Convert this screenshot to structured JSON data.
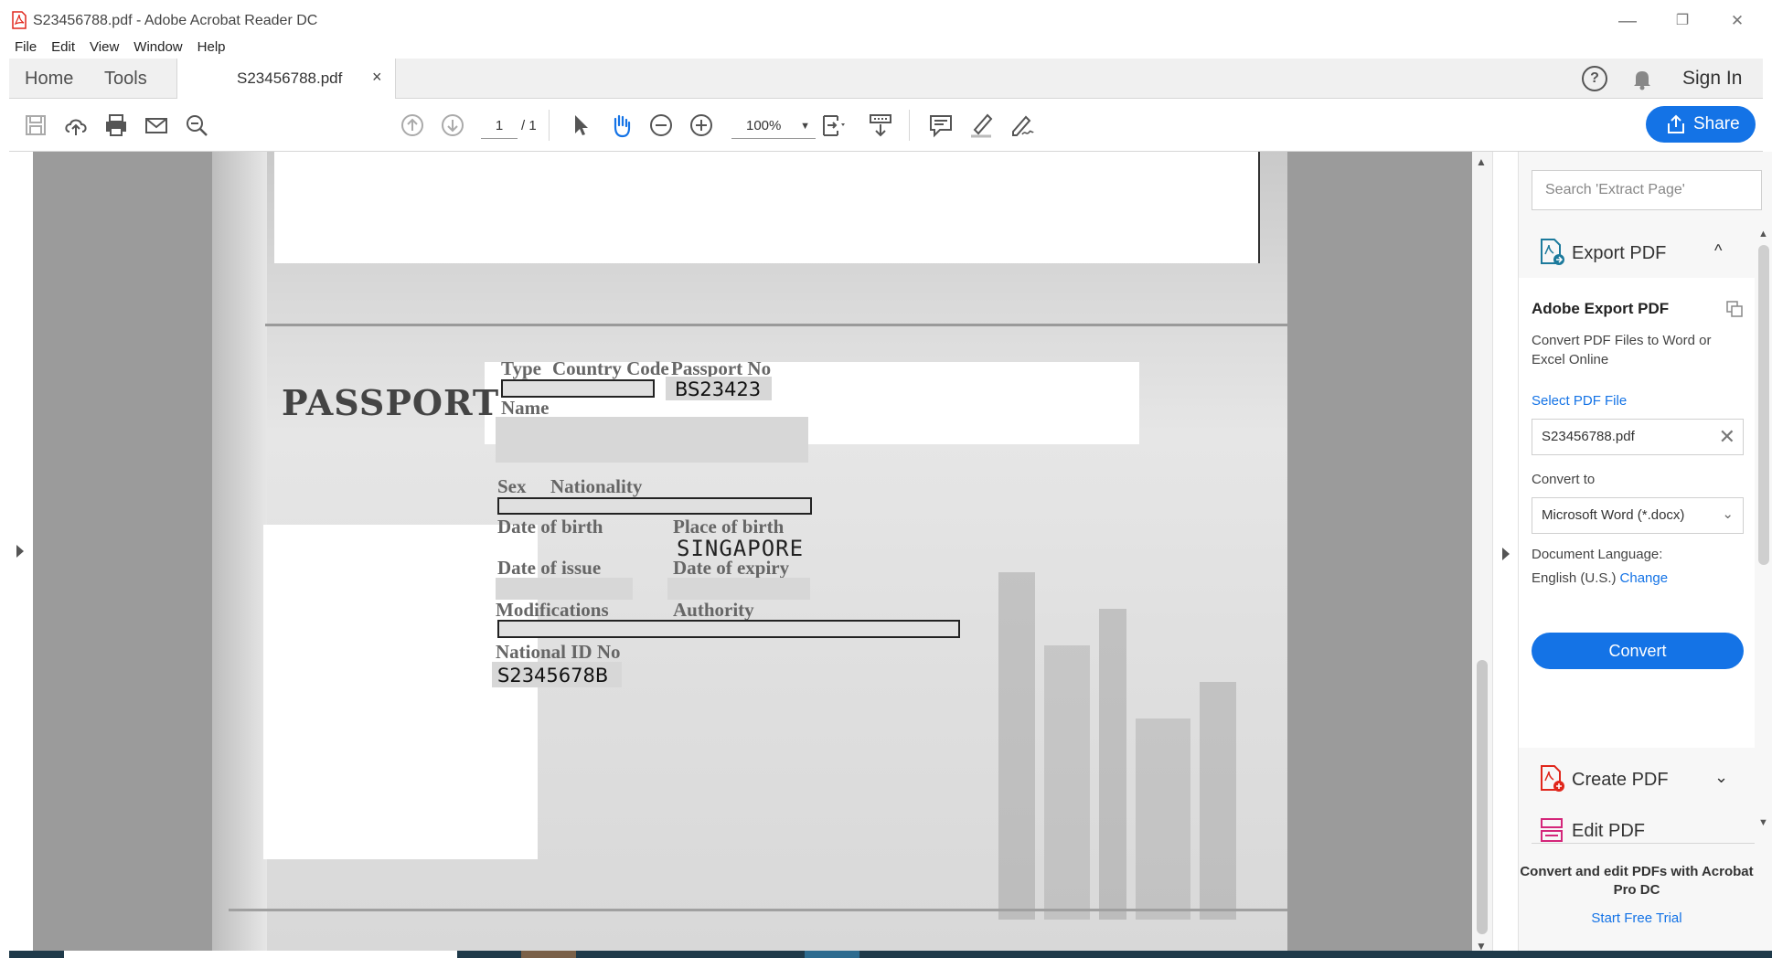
{
  "window": {
    "title": "S23456788.pdf - Adobe Acrobat Reader DC",
    "minimize": "—",
    "restore": "❐",
    "close": "✕"
  },
  "menu": [
    "File",
    "Edit",
    "View",
    "Window",
    "Help"
  ],
  "tabs": {
    "home": "Home",
    "tools": "Tools",
    "doc": "S23456788.pdf",
    "doc_close": "×"
  },
  "header_right": {
    "help": "?",
    "signin": "Sign In"
  },
  "toolbar": {
    "page_current": "1",
    "page_total": "/ 1",
    "zoom": "100%",
    "zoom_caret": "▼",
    "share": "Share"
  },
  "document": {
    "passport_label": "PASSPORT",
    "labels": {
      "type": "Type",
      "country_code": "Country Code",
      "passport_no": "Passport No",
      "name": "Name",
      "sex": "Sex",
      "nationality": "Nationality",
      "dob": "Date of birth",
      "pob": "Place of birth",
      "doi": "Date of issue",
      "doe": "Date of expiry",
      "modifications": "Modifications",
      "authority": "Authority",
      "national_id": "National ID No"
    },
    "values": {
      "passport_no": "BS23423",
      "place_of_birth": "SINGAPORE",
      "national_id": "S2345678B"
    }
  },
  "right_pane": {
    "search_placeholder": "Search 'Extract Page'",
    "export_title": "Export PDF",
    "export_chevron": "^",
    "adobe_export_title": "Adobe Export PDF",
    "adobe_export_desc": "Convert PDF Files to Word or Excel Online",
    "select_file_link": "Select PDF File",
    "file_name": "S23456788.pdf",
    "file_clear": "✕",
    "convert_to_label": "Convert to",
    "convert_to_value": "Microsoft Word (*.docx)",
    "convert_to_chevron": "⌄",
    "doc_language_label": "Document Language:",
    "doc_language_value": "English (U.S.)",
    "change_link": "Change",
    "convert_button": "Convert",
    "create_pdf": "Create PDF",
    "create_chevron": "⌄",
    "edit_pdf": "Edit PDF",
    "promo": "Convert and edit PDFs with Acrobat Pro DC",
    "trial_link": "Start Free Trial"
  },
  "colors": {
    "accent": "#1473e6",
    "adobe_red": "#e0261b"
  }
}
